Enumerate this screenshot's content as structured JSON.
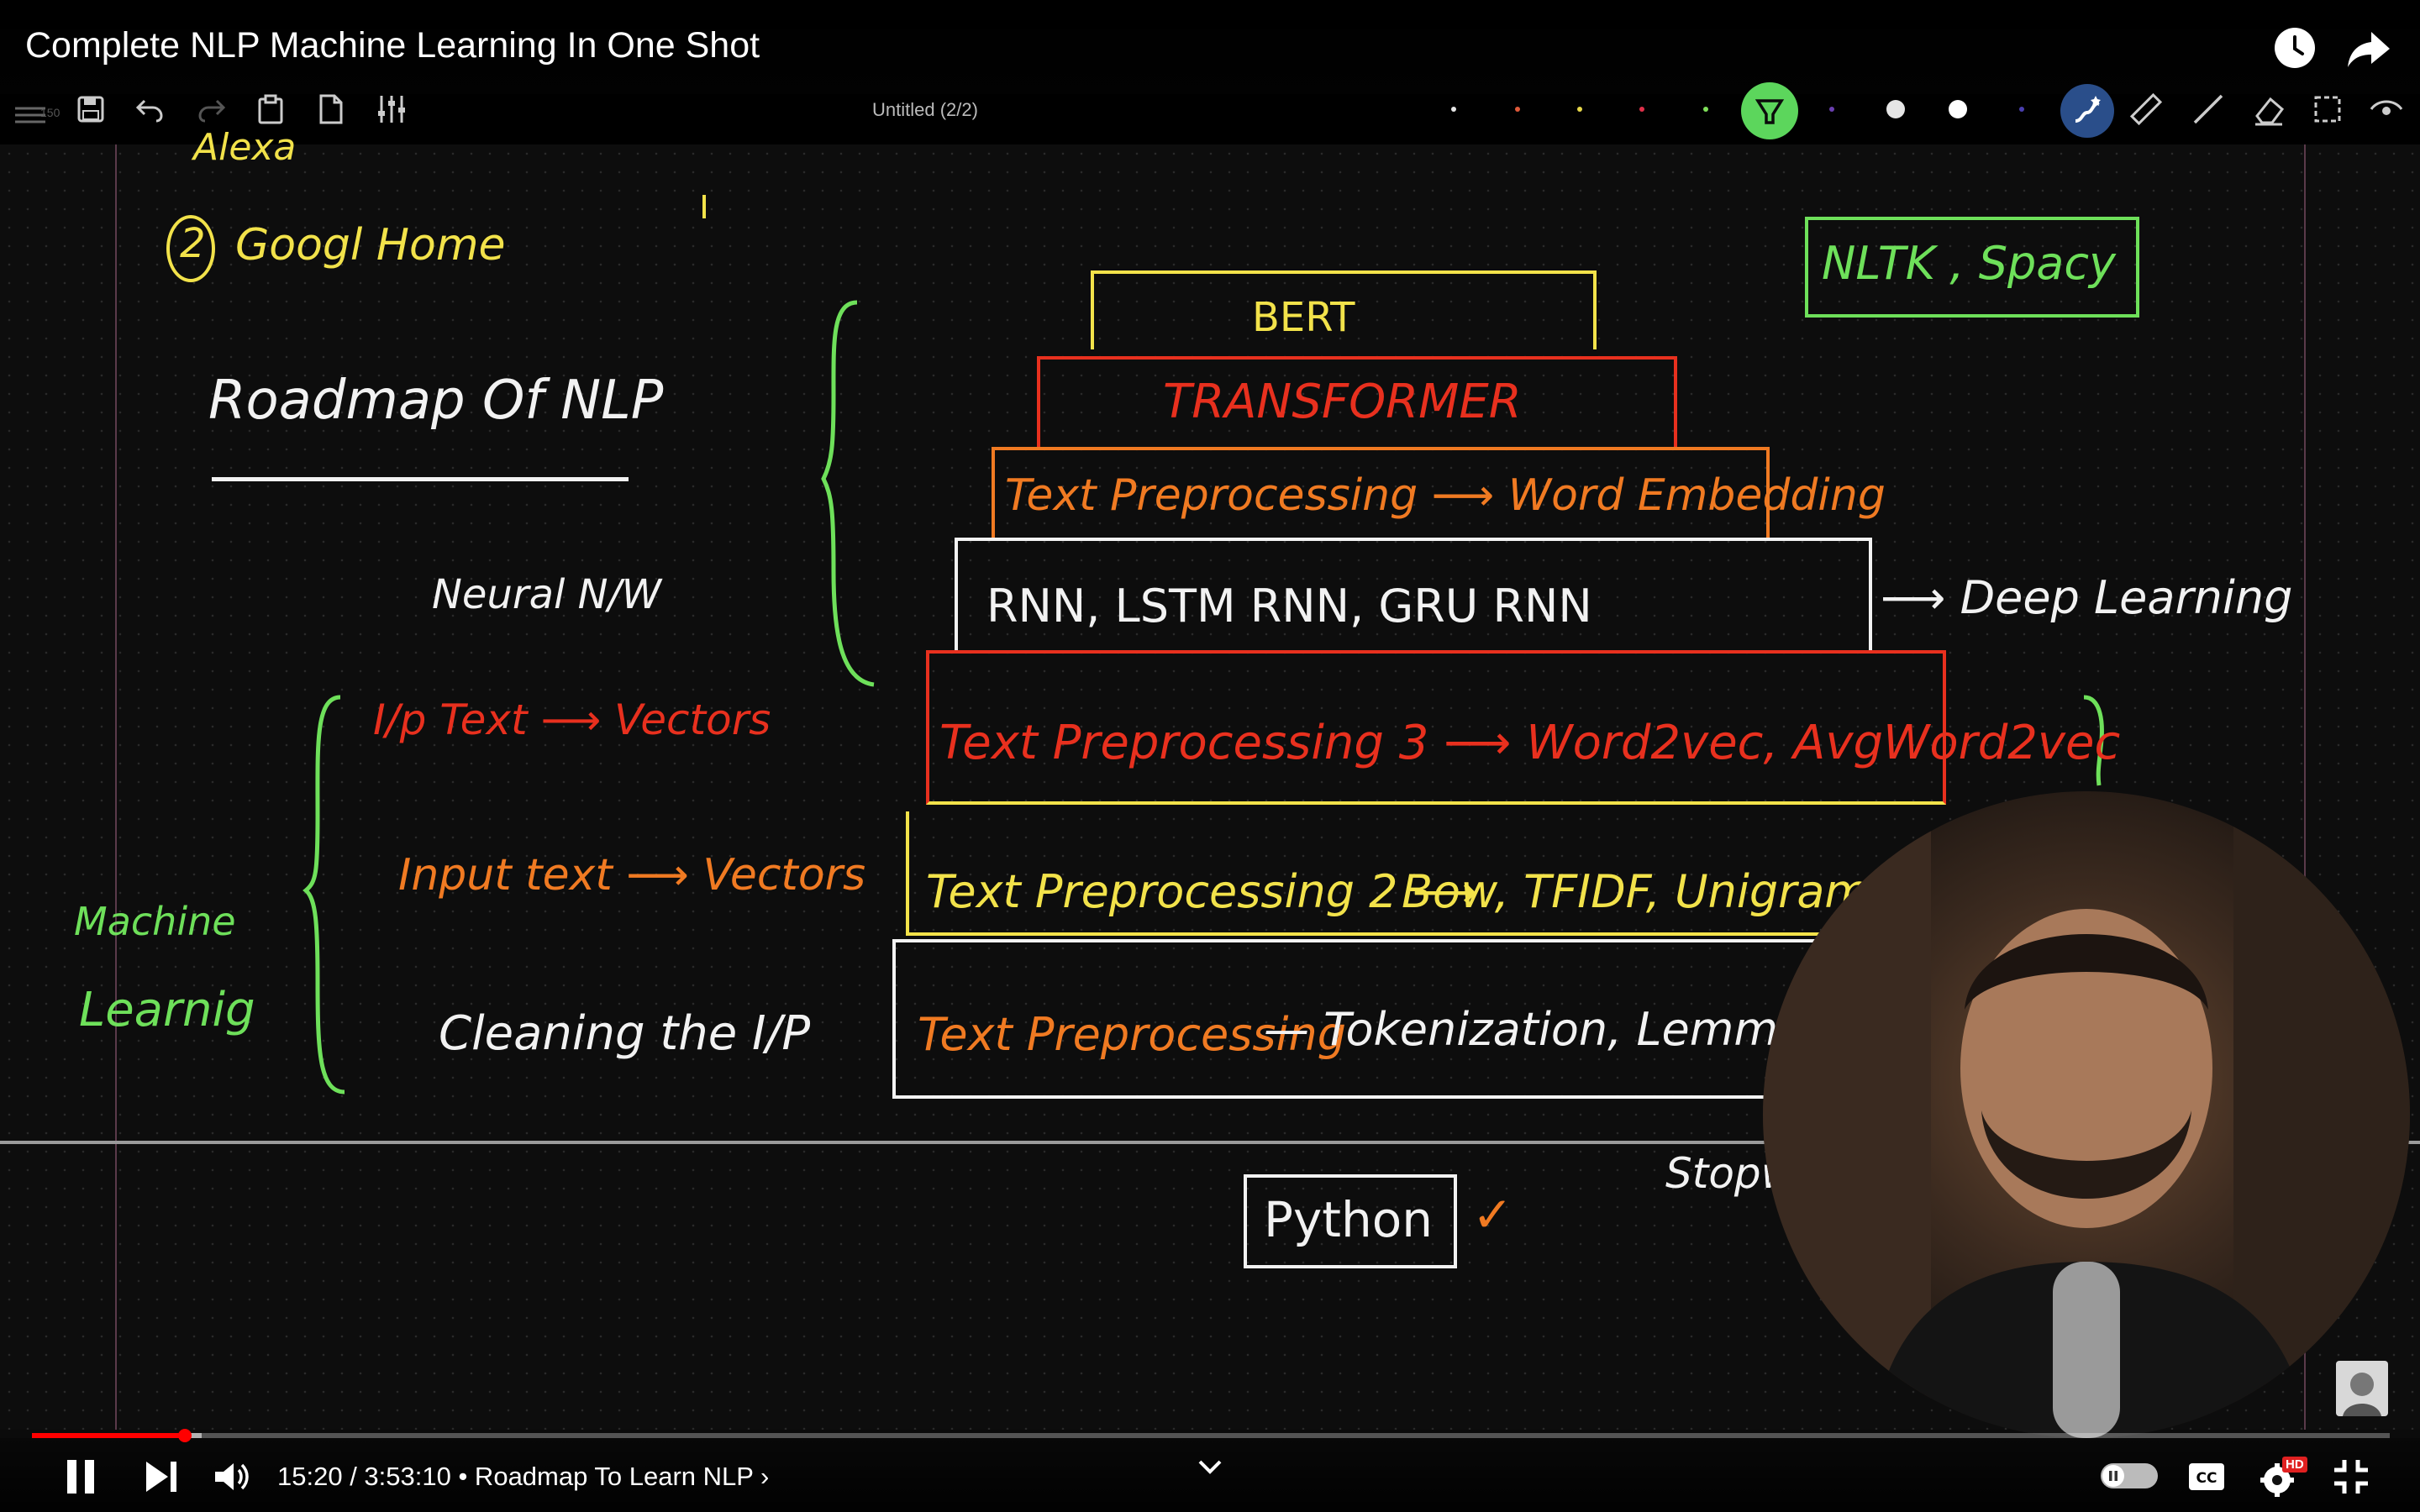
{
  "video": {
    "title": "Complete NLP Machine Learning In One Shot",
    "current_time": "15:20",
    "duration": "3:53:10",
    "time_display": "15:20 / 3:53:10",
    "chapter": "• Roadmap To Learn NLP",
    "chapter_chevron": "›",
    "progress_fraction": 0.065,
    "quality_badge": "HD"
  },
  "whiteboard": {
    "document_title": "Untitled (2/2)",
    "zoom_hint": "150",
    "pen_colors": [
      "#e6e6e6",
      "#e05a3a",
      "#e8d84a",
      "#e0304a",
      "#7fe05a",
      "#7fe05a",
      "#6a3fb0",
      "#e6e6e6",
      "#ffffff",
      "#4a3fb0"
    ],
    "active_color": "#5cd65c",
    "icons": [
      "menu-icon",
      "save-icon",
      "undo-icon",
      "redo-icon",
      "clipboard-icon",
      "page-icon",
      "sliders-icon",
      "highlighter-icon",
      "magic-pen-icon",
      "ruler-icon",
      "line-icon",
      "eraser-icon",
      "select-icon",
      "eye-icon"
    ]
  },
  "notes": {
    "alexa_fragment": "Alexa",
    "google_home_num": "2",
    "google_home": "Googl Home",
    "roadmap_title": "Roadmap Of NLP",
    "neural_nw": "Neural N/W",
    "ml_label_1": "Machine",
    "ml_label_2": "Learnig",
    "ml_row1": "I/p Text ⟶ Vectors",
    "ml_row2": "Input text ⟶ Vectors",
    "ml_row3": "Cleaning the I/P",
    "nltk_spacy": "NLTK , Spacy",
    "bert": "BERT",
    "transformer": "TRANSFORMER",
    "text_prep_word_emb": "Text Preprocessing ⟶ Word Embedding",
    "rnn_row": "RNN, LSTM RNN, GRU RNN",
    "deep_learning": "⟶ Deep Learning",
    "text_prep_3": "Text Preprocessing 3 ⟶ Word2vec, AvgWord2vec",
    "text_prep_2_a": "Text Preprocessing 2 ⟶",
    "text_prep_2_b": "Bow, TFIDF, Unigram",
    "text_prep_1": "Text Preprocessing",
    "tokenization": "— Tokenization, Lemmatization",
    "stopwords": "Stopwords",
    "python": "Python",
    "check": "✓"
  },
  "colors": {
    "yellow": "#f2e24a",
    "red": "#e8301e",
    "orange": "#f07a22",
    "green": "#6ee05a",
    "white": "#f2f2f2"
  }
}
